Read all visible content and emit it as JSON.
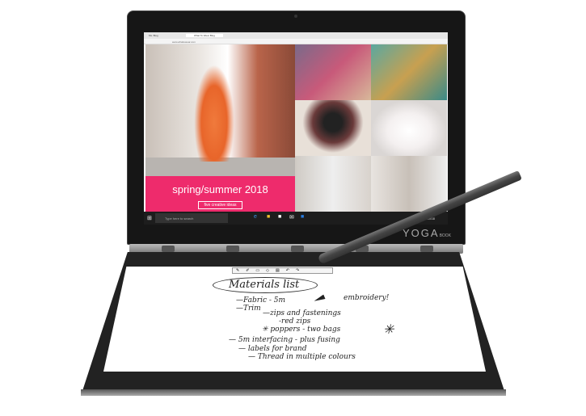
{
  "browser": {
    "tabs": [
      "Ms. Blog",
      "What To Wear Blog"
    ],
    "address": "www.whattowear.com"
  },
  "banner": {
    "title": "spring/summer 2018",
    "button": "five creative ideas"
  },
  "taskbar": {
    "search_placeholder": "Type here to search",
    "lang": "ENG",
    "region": "US",
    "time": "2:16 AM",
    "date": "6/29/2018"
  },
  "brand": {
    "name": "YOGA",
    "sub": "BOOK"
  },
  "notes": {
    "title": "Materials list",
    "lines": [
      "—Fabric - 5m",
      "—Trim",
      "embroidery!",
      "—zips and fastenings",
      "-red zips",
      "✳ poppers - two bags",
      "— 5m interfacing - plus fusing",
      "— labels for brand",
      "— Thread in multiple colours"
    ]
  },
  "colors": {
    "banner": "#ee2b6c",
    "taskbar": "#1d1d1d"
  }
}
